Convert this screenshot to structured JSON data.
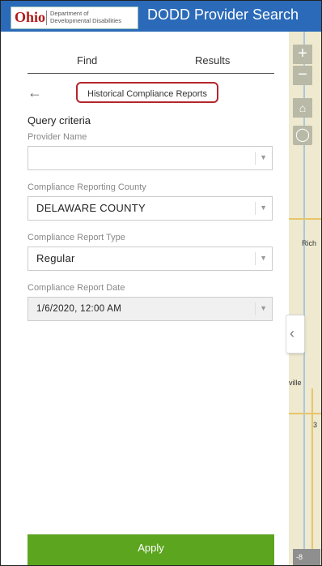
{
  "header": {
    "logo_ohio": "Ohio",
    "logo_dept_line1": "Department of",
    "logo_dept_line2": "Developmental Disabilities",
    "title": "DODD Provider Search"
  },
  "tabs": {
    "find": "Find",
    "results": "Results"
  },
  "nav": {
    "report_button": "Historical Compliance Reports"
  },
  "query": {
    "heading": "Query criteria",
    "provider_name_label": "Provider Name",
    "provider_name_value": "",
    "county_label": "Compliance Reporting County",
    "county_value": "DELAWARE COUNTY",
    "report_type_label": "Compliance Report Type",
    "report_type_value": "Regular",
    "report_date_label": "Compliance Report Date",
    "report_date_value": "1/6/2020, 12:00 AM"
  },
  "apply_label": "Apply",
  "map": {
    "zoom_in": "+",
    "zoom_out": "−",
    "label_rich": "Rich",
    "label_ville": "ville",
    "label_num": "3",
    "scale_text": "-8"
  },
  "colors": {
    "header_bg": "#2a6ab8",
    "apply_bg": "#5ba51f",
    "highlight_border": "#b3262b"
  }
}
